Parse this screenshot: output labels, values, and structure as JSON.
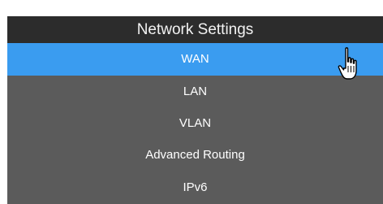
{
  "menu": {
    "title": "Network Settings",
    "items": [
      {
        "label": "WAN",
        "active": true
      },
      {
        "label": "LAN",
        "active": false
      },
      {
        "label": "VLAN",
        "active": false
      },
      {
        "label": "Advanced Routing",
        "active": false
      },
      {
        "label": "IPv6",
        "active": false
      }
    ]
  },
  "cursor": {
    "icon": "hand-pointer-icon"
  },
  "colors": {
    "header_bg": "#2c2c2c",
    "list_bg": "#5b5b5b",
    "active_bg": "#3a9cf0"
  }
}
